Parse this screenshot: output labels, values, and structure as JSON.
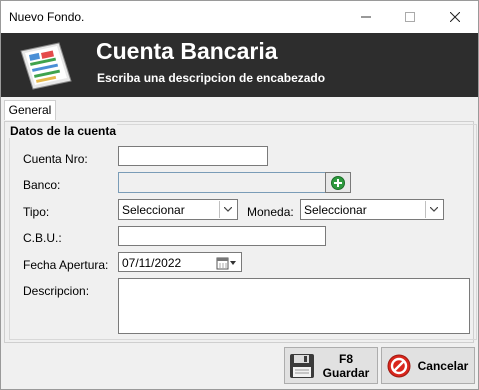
{
  "window": {
    "title": "Nuevo Fondo.",
    "minimize_glyph": "—",
    "maximize_glyph": "☐",
    "close_glyph": "✕"
  },
  "header": {
    "title": "Cuenta Bancaria",
    "subtitle": "Escriba una descripcion de encabezado",
    "logo_icon": "ledger-book-icon"
  },
  "tabs": [
    {
      "label": "General",
      "active": true
    }
  ],
  "group": {
    "legend": "Datos de la cuenta"
  },
  "form": {
    "cuenta_nro": {
      "label": "Cuenta Nro:",
      "value": ""
    },
    "banco": {
      "label": "Banco:",
      "value": "",
      "add_icon": "add-green-icon"
    },
    "tipo": {
      "label": "Tipo:",
      "value": "Seleccionar"
    },
    "moneda": {
      "label": "Moneda:",
      "value": "Seleccionar"
    },
    "cbu": {
      "label": "C.B.U.:",
      "value": ""
    },
    "fecha_apertura": {
      "label": "Fecha Apertura:",
      "value": "07/11/2022",
      "icon": "calendar-dropdown-icon"
    },
    "descripcion": {
      "label": "Descripcion:",
      "value": ""
    }
  },
  "buttons": {
    "guardar": {
      "key": "F8",
      "label": "Guardar",
      "icon": "floppy-disk-icon"
    },
    "cancelar": {
      "label": "Cancelar",
      "icon": "cancel-red-icon"
    }
  },
  "colors": {
    "header_bg": "#2d2d2d",
    "header_text": "#ffffff",
    "window_bg": "#f0f0f0",
    "cancel_red": "#d9261c",
    "add_green": "#2e9a3e"
  }
}
